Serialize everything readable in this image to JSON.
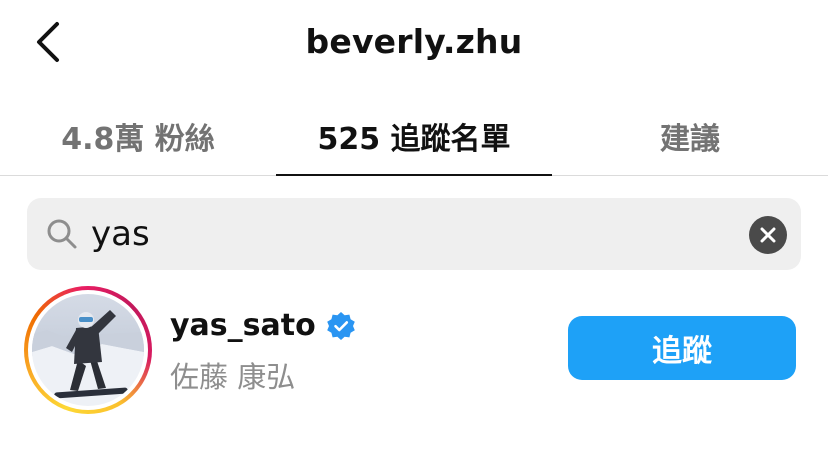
{
  "header": {
    "title": "beverly.zhu",
    "back_icon": "chevron-left-icon"
  },
  "tabs": [
    {
      "label": "4.8萬 粉絲",
      "active": false
    },
    {
      "label": "525 追蹤名單",
      "active": true
    },
    {
      "label": "建議",
      "active": false
    }
  ],
  "search": {
    "value": "yas",
    "icon": "search-icon",
    "clear_icon": "clear-icon"
  },
  "results": [
    {
      "username": "yas_sato",
      "verified": true,
      "full_name": "佐藤 康弘",
      "button_label": "追蹤",
      "avatar_icon": "snowboarder-photo"
    }
  ],
  "colors": {
    "follow_button": "#1ea1f7",
    "verified_badge": "#2a95f2",
    "tab_active": "#111111",
    "tab_inactive": "#737373",
    "search_bg": "#efefef"
  }
}
